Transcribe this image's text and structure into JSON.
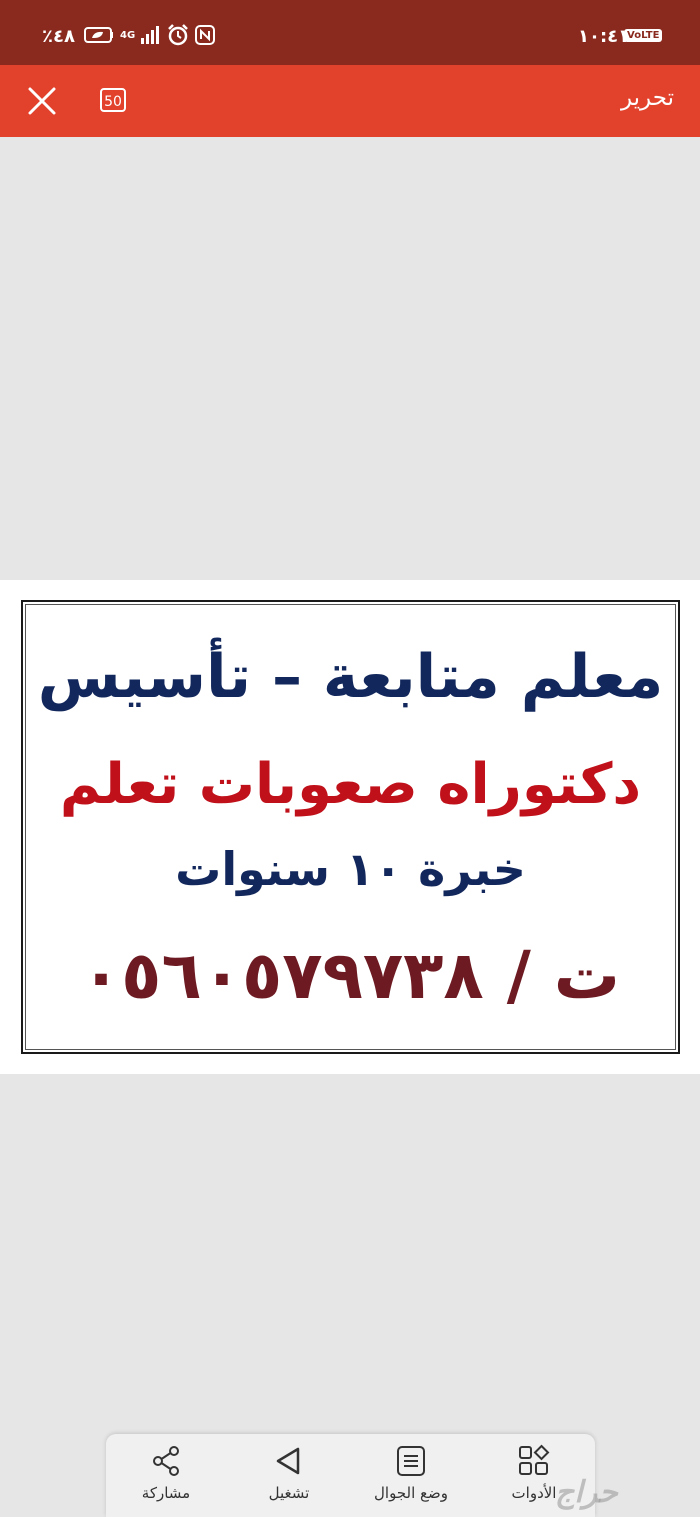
{
  "status_bar": {
    "time": "١٠:٤١",
    "network_badge": "VoLTE",
    "battery_percent": "٪٤٨",
    "network_type": "4G",
    "icons": [
      "battery-icon",
      "signal-icon",
      "alarm-icon",
      "nfc-icon"
    ]
  },
  "toolbar": {
    "edit_label": "تحرير",
    "page_badge": "50",
    "close_icon": "close-icon"
  },
  "document": {
    "line1": "معلم متابعة – تأسيس",
    "line2": "دكتوراه صعوبات تعلم",
    "line3": "خبرة ١٠ سنوات",
    "line4": "ت / ٠٥٦٠٥٧٩٧٣٨"
  },
  "bottom_bar": {
    "tools_label": "الأدوات",
    "mobile_mode_label": "وضع الجوال",
    "play_label": "تشغيل",
    "share_label": "مشاركة"
  },
  "watermark": "حراج",
  "colors": {
    "status_bar": "#8a2a1f",
    "toolbar": "#e2412c",
    "line_navy": "#12275c",
    "line_red": "#c0101a",
    "line_maroon": "#6e1a22"
  }
}
